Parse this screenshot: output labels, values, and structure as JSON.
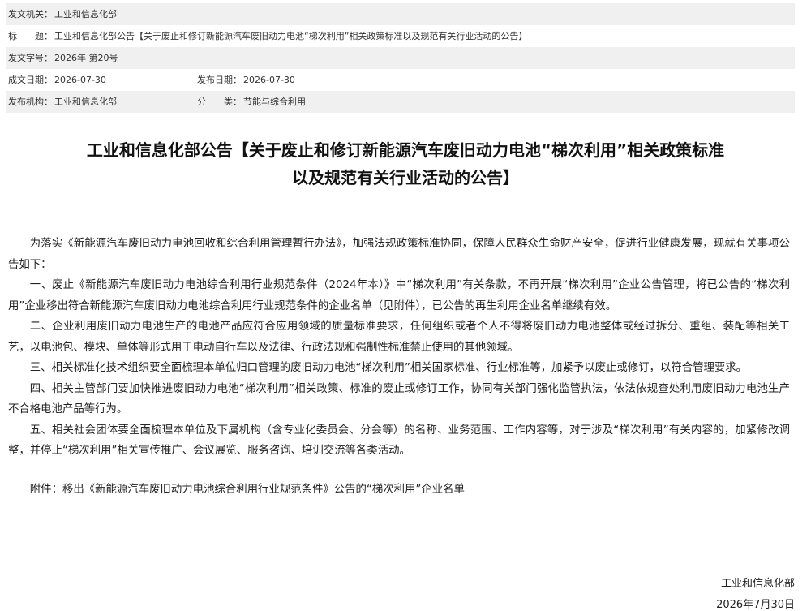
{
  "meta": {
    "issuer_label": "发文机关：",
    "issuer": "工业和信息化部",
    "title_label": "标　　题：",
    "title": "工业和信息化部公告【关于废止和修订新能源汽车废旧动力电池“梯次利用”相关政策标准以及规范有关行业活动的公告】",
    "doc_no_label": "发文字号：",
    "doc_no": "2026年 第20号",
    "created_label": "成文日期：",
    "created": "2026-07-30",
    "published_label": "发布日期：",
    "published": "2026-07-30",
    "org_label": "发布机构：",
    "org": "工业和信息化部",
    "category_label": "分　　类：",
    "category": "节能与综合利用"
  },
  "document": {
    "title_line1": "工业和信息化部公告【关于废止和修订新能源汽车废旧动力电池“梯次利用”相关政策标准",
    "title_line2": "以及规范有关行业活动的公告】",
    "paragraphs": [
      "为落实《新能源汽车废旧动力电池回收和综合利用管理暂行办法》，加强法规政策标准协同，保障人民群众生命财产安全，促进行业健康发展，现就有关事项公告如下：",
      "一、废止《新能源汽车废旧动力电池综合利用行业规范条件（2024年本）》中“梯次利用”有关条款，不再开展“梯次利用”企业公告管理，将已公告的“梯次利用”企业移出符合新能源汽车废旧动力电池综合利用行业规范条件的企业名单（见附件），已公告的再生利用企业名单继续有效。",
      "二、企业利用废旧动力电池生产的电池产品应符合应用领域的质量标准要求，任何组织或者个人不得将废旧动力电池整体或经过拆分、重组、装配等相关工艺，以电池包、模块、单体等形式用于电动自行车以及法律、行政法规和强制性标准禁止使用的其他领域。",
      "三、相关标准化技术组织要全面梳理本单位归口管理的废旧动力电池“梯次利用”相关国家标准、行业标准等，加紧予以废止或修订，以符合管理要求。",
      "四、相关主管部门要加快推进废旧动力电池“梯次利用”相关政策、标准的废止或修订工作，协同有关部门强化监管执法，依法依规查处利用废旧动力电池生产不合格电池产品等行为。",
      "五、相关社会团体要全面梳理本单位及下属机构（含专业化委员会、分会等）的名称、业务范围、工作内容等，对于涉及“梯次利用”有关内容的，加紧修改调整，并停止“梯次利用”相关宣传推广、会议展览、服务咨询、培训交流等各类活动。"
    ],
    "attachment": "附件：移出《新能源汽车废旧动力电池综合利用行业规范条件》公告的“梯次利用”企业名单",
    "signer": "工业和信息化部",
    "sign_date": "2026年7月30日"
  }
}
